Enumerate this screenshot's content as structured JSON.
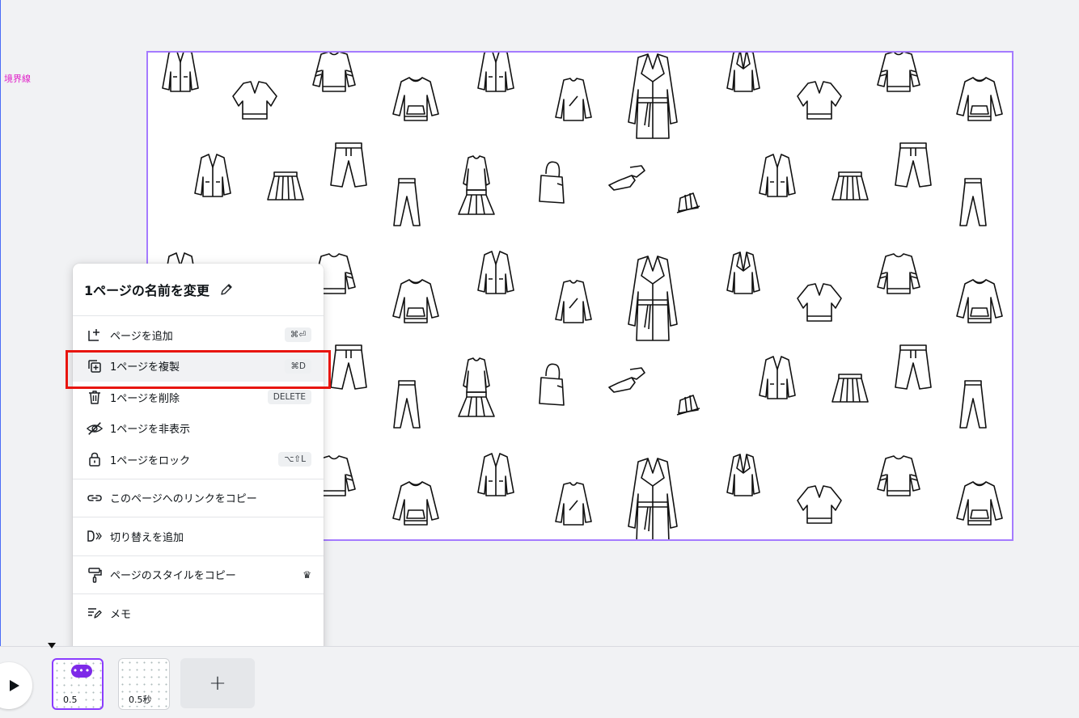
{
  "guide_label": "境界線",
  "context_menu": {
    "title": "1ページの名前を変更",
    "sections": [
      [
        {
          "label": "ページを追加",
          "icon": "add-page-icon",
          "shortcut": "⌘⏎"
        },
        {
          "label": "1ページを複製",
          "icon": "duplicate-page-icon",
          "shortcut": "⌘D"
        },
        {
          "label": "1ページを削除",
          "icon": "trash-icon",
          "shortcut": "DELETE"
        },
        {
          "label": "1ページを非表示",
          "icon": "hide-eye-icon",
          "shortcut": ""
        },
        {
          "label": "1ページをロック",
          "icon": "lock-icon",
          "shortcut": "⌥⇧L"
        }
      ],
      [
        {
          "label": "このページへのリンクをコピー",
          "icon": "link-icon",
          "shortcut": ""
        }
      ],
      [
        {
          "label": "切り替えを追加",
          "icon": "transition-icon",
          "shortcut": ""
        }
      ],
      [
        {
          "label": "ページのスタイルをコピー",
          "icon": "paint-roller-icon",
          "shortcut": "",
          "badge": "crown-icon"
        }
      ],
      [
        {
          "label": "メモ",
          "icon": "notes-icon",
          "shortcut": ""
        }
      ]
    ]
  },
  "filmstrip": {
    "pages": [
      {
        "duration": "0.5",
        "active": true
      },
      {
        "duration": "0.5秒",
        "active": false
      }
    ],
    "more_label": "•••",
    "add_label": "+"
  },
  "colors": {
    "accent": "#8b3dff",
    "highlight": "#e8150f",
    "canvas_border": "#a57bff"
  }
}
